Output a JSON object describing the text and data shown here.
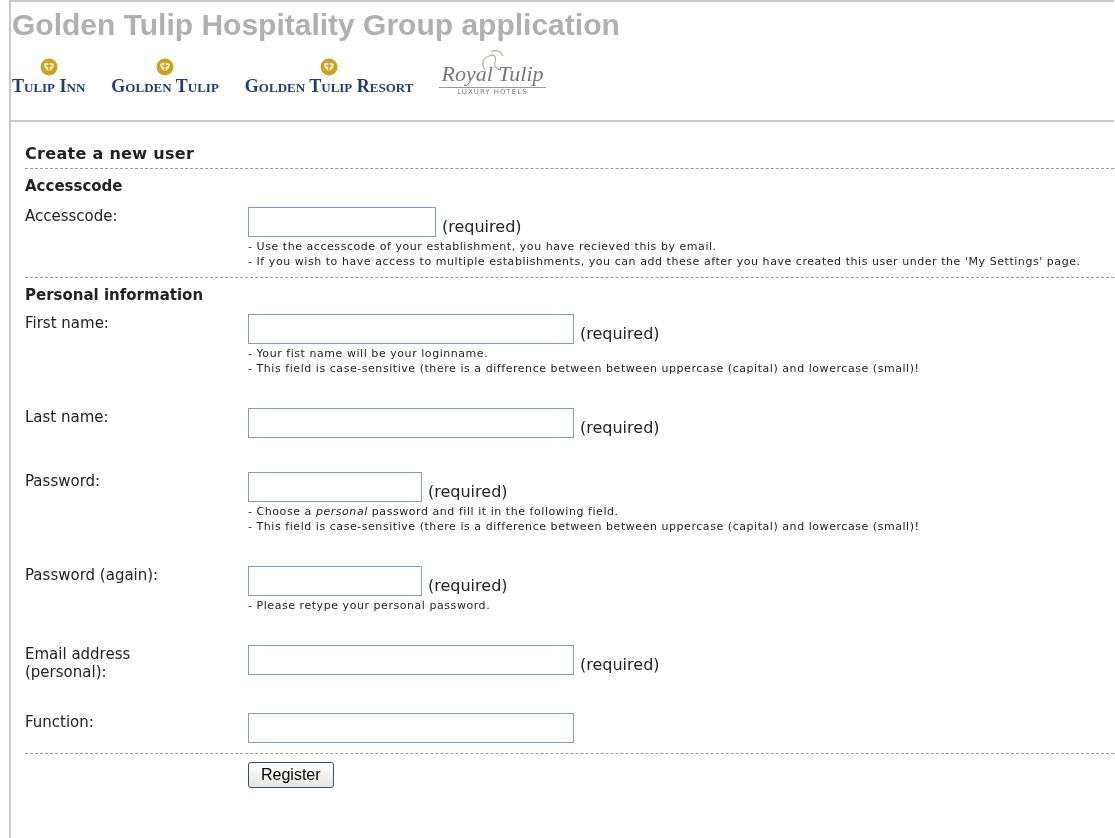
{
  "header": {
    "title": "Golden Tulip Hospitality Group application",
    "brands": [
      {
        "name": "Tulip Inn",
        "kind": "emblem"
      },
      {
        "name": "Golden Tulip",
        "kind": "emblem"
      },
      {
        "name": "Golden Tulip Resort",
        "kind": "emblem"
      },
      {
        "name": "Royal Tulip",
        "tagline": "LUXURY HOTELS",
        "kind": "script"
      }
    ]
  },
  "form": {
    "title": "Create a new user",
    "sections": [
      {
        "heading": "Accesscode",
        "fields": [
          {
            "label": "Accesscode:",
            "kind": "short",
            "note": "(required)",
            "hints": [
              "- Use the accesscode of your establishment, you have recieved this by email.",
              "- If you wish to have access to multiple establishments, you can add these after you have created this user under the 'My Settings' page."
            ]
          }
        ]
      },
      {
        "heading": "Personal information",
        "fields": [
          {
            "label": "First name:",
            "kind": "long",
            "note": "(required)",
            "hints": [
              "- Your fist name will be your loginname.",
              "- This field is case-sensitive (there is a difference between between uppercase (capital) and lowercase (small)!"
            ]
          },
          {
            "label": "Last name:",
            "kind": "long",
            "note": "(required)"
          },
          {
            "label": "Password:",
            "kind": "medium",
            "note": "(required)",
            "hints": [
              "- Choose a *personal* password and fill it in the following field.",
              "- This field is case-sensitive (there is a difference between between uppercase (capital) and lowercase (small)!"
            ]
          },
          {
            "label": "Password (again):",
            "kind": "medium",
            "note": "(required)",
            "hints": [
              "- Please retype your personal password."
            ]
          },
          {
            "label": "Email address (personal):",
            "kind": "long",
            "note": "(required)"
          },
          {
            "label": "Function:",
            "kind": "long"
          }
        ]
      }
    ],
    "submit": "Register"
  }
}
